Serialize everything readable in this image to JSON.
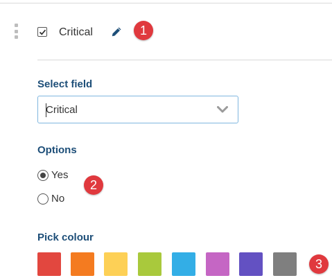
{
  "field": {
    "label": "Critical",
    "checked": true
  },
  "badges": [
    "1",
    "2",
    "3"
  ],
  "select_field": {
    "title": "Select field",
    "value": "Critical"
  },
  "options": {
    "title": "Options",
    "items": [
      {
        "label": "Yes",
        "selected": true
      },
      {
        "label": "No",
        "selected": false
      }
    ]
  },
  "colours": {
    "title": "Pick colour",
    "swatches": [
      "#e2473f",
      "#f47b20",
      "#fdd056",
      "#a9c93c",
      "#33aee6",
      "#c566c4",
      "#6351c2",
      "#7f7f7f"
    ]
  },
  "icons": {
    "drag": "drag-handle-icon",
    "check": "checkmark-icon",
    "edit": "pencil-icon",
    "dropdown": "chevron-down-icon"
  },
  "accent": "#1d4e78",
  "badge_color": "#e0393e"
}
